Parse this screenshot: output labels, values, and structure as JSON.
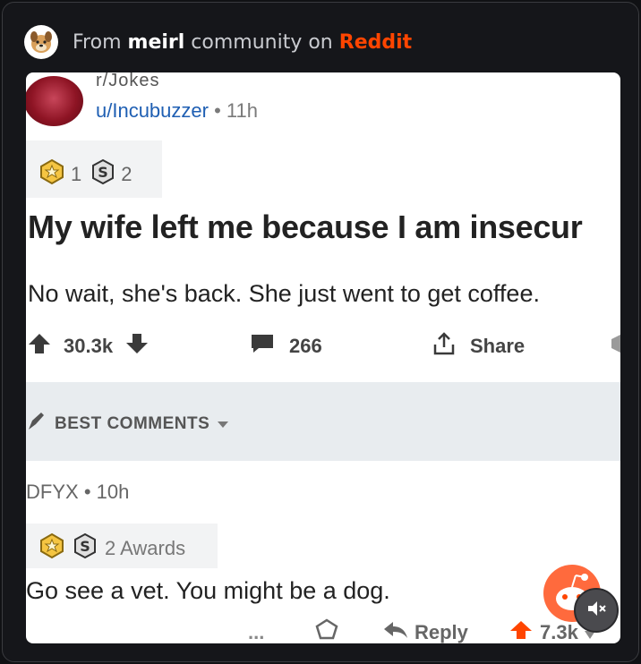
{
  "header": {
    "prefix": "From",
    "community": "meirl",
    "middle": "community on",
    "platform": "Reddit",
    "platform_color": "#ff4500"
  },
  "post": {
    "subreddit": "r/Jokes",
    "username": "u/Incubuzzer",
    "time": "• 11h",
    "awards": [
      {
        "icon": "gold-award-icon",
        "count": "1"
      },
      {
        "icon": "silver-award-icon",
        "count": "2"
      }
    ],
    "title": "My wife left me because I am insecur",
    "body": "No wait, she's back. She just went to get coffee.",
    "votes": "30.3k",
    "comments": "266",
    "share_label": "Share"
  },
  "sort": {
    "label": "BEST COMMENTS"
  },
  "comment": {
    "username": "DFYX",
    "time": "• 10h",
    "awards_label": "2 Awards",
    "body": "Go see a vet. You might be a dog.",
    "more": "...",
    "reply_label": "Reply",
    "votes": "7.3k"
  },
  "icons": {
    "upvote_color": "#ff4500",
    "link_color": "#1f5fb3"
  }
}
